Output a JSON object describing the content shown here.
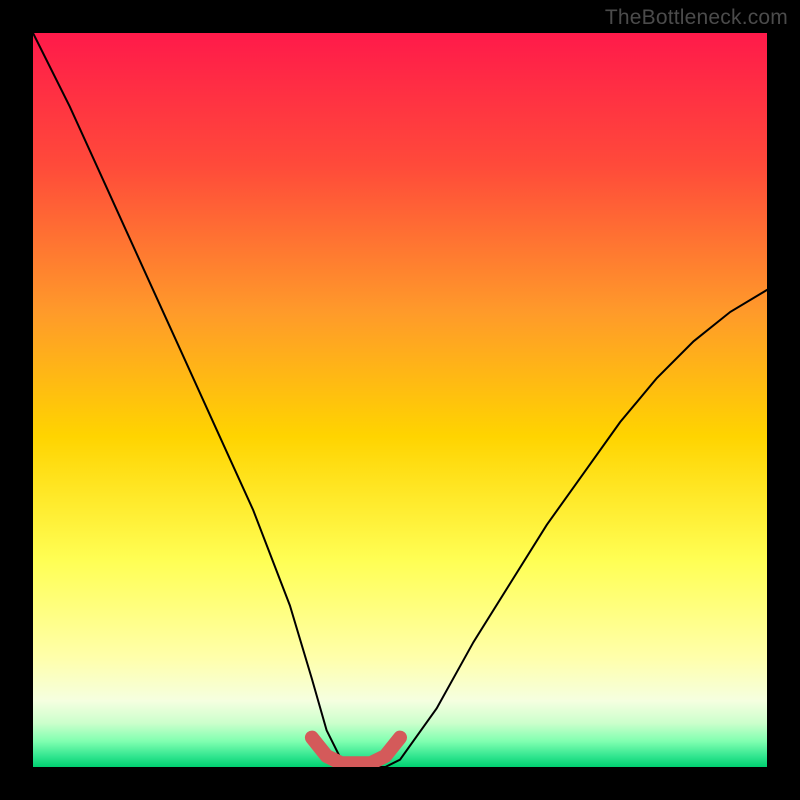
{
  "watermark": "TheBottleneck.com",
  "colors": {
    "frame": "#000000",
    "grad_top": "#ff1a4a",
    "grad_mid1": "#ff6a2a",
    "grad_mid2": "#ffd400",
    "grad_mid3": "#ffff66",
    "grad_low": "#f7ffe0",
    "grad_bottom_band": "#66ff99",
    "grad_bottom": "#00e07a",
    "curve": "#000000",
    "highlight": "#d45a5a"
  },
  "chart_data": {
    "type": "line",
    "title": "",
    "xlabel": "",
    "ylabel": "",
    "xlim": [
      0,
      100
    ],
    "ylim": [
      0,
      100
    ],
    "series": [
      {
        "name": "bottleneck-curve",
        "x": [
          0,
          5,
          10,
          15,
          20,
          25,
          30,
          35,
          38,
          40,
          42,
          44,
          46,
          48,
          50,
          55,
          60,
          65,
          70,
          75,
          80,
          85,
          90,
          95,
          100
        ],
        "y": [
          100,
          90,
          79,
          68,
          57,
          46,
          35,
          22,
          12,
          5,
          1,
          0,
          0,
          0,
          1,
          8,
          17,
          25,
          33,
          40,
          47,
          53,
          58,
          62,
          65
        ]
      }
    ],
    "highlight_segment": {
      "name": "optimal-range",
      "x": [
        38,
        40,
        42,
        44,
        46,
        48,
        50
      ],
      "y": [
        4,
        1.5,
        0.5,
        0.5,
        0.5,
        1.5,
        4
      ]
    }
  }
}
